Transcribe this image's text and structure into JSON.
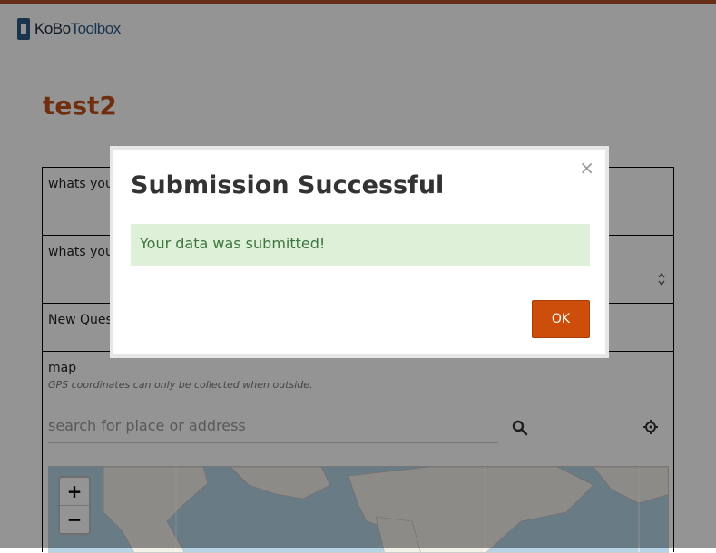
{
  "brand": {
    "kobo": "KoBo",
    "toolbox": "Toolbox"
  },
  "form": {
    "title": "test2"
  },
  "questions": [
    {
      "label": "whats you"
    },
    {
      "label": "whats you"
    },
    {
      "label": "New Ques"
    },
    {
      "label": "map",
      "hint": "GPS coordinates can only be collected when outside."
    }
  ],
  "map": {
    "search_placeholder": "search for place or address",
    "zoom_in": "+",
    "zoom_out": "−"
  },
  "modal": {
    "title": "Submission Successful",
    "close": "×",
    "message": "Your data was submitted!",
    "ok_label": "OK"
  },
  "colors": {
    "brand_accent": "#c0501a",
    "button": "#cc4e0a",
    "success_bg": "#dff0d8",
    "success_text": "#3c763d"
  }
}
